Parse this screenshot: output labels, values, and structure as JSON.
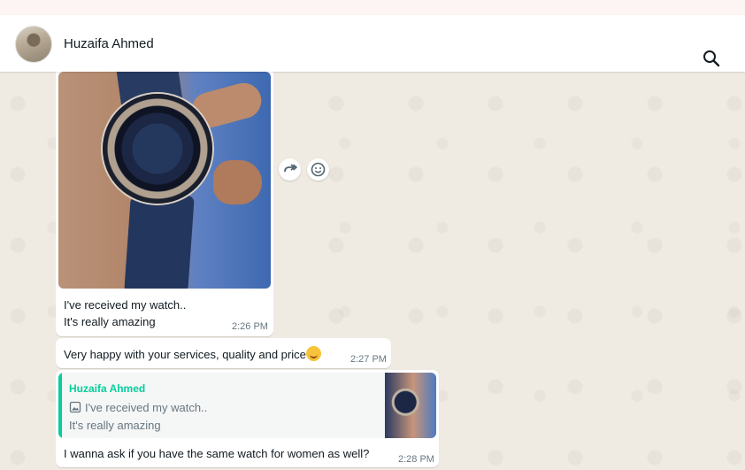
{
  "header": {
    "contact_name": "Huzaifa Ahmed",
    "search_icon": "search-icon"
  },
  "messages": [
    {
      "type": "image",
      "caption_line1": "I've received my watch..",
      "caption_line2": "It's really amazing",
      "time": "2:26 PM"
    },
    {
      "type": "text",
      "text": "Very happy with your services, quality and price",
      "emoji": "smiling-face-icon",
      "time": "2:27 PM"
    },
    {
      "type": "reply",
      "quoted_name": "Huzaifa Ahmed",
      "quoted_line1": "I've received my watch..",
      "quoted_line2": "It's really amazing",
      "text": "I wanna ask if you have the same watch for women as well?",
      "time": "2:28 PM"
    }
  ],
  "actions": {
    "forward_icon": "forward-icon",
    "emoji_icon": "emoji-icon"
  },
  "colors": {
    "accent": "#06cf9c",
    "chat_bg": "#efeae2",
    "bubble": "#ffffff",
    "meta_text": "#667781"
  }
}
